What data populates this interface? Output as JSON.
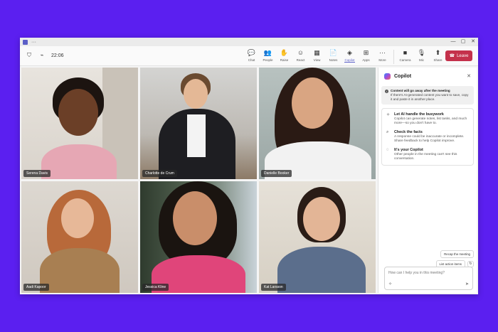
{
  "titlebar": {
    "more": "···",
    "controls": [
      "—",
      "▢",
      "✕"
    ]
  },
  "toolbar": {
    "timer": "22:06",
    "buttons": [
      {
        "label": "Chat",
        "icon": "chat-icon",
        "glyph": "💬"
      },
      {
        "label": "People",
        "icon": "people-icon",
        "glyph": "👥"
      },
      {
        "label": "Raise",
        "icon": "raise-hand-icon",
        "glyph": "✋"
      },
      {
        "label": "React",
        "icon": "react-icon",
        "glyph": "☺"
      },
      {
        "label": "View",
        "icon": "view-icon",
        "glyph": "▦"
      },
      {
        "label": "Notes",
        "icon": "notes-icon",
        "glyph": "📄"
      },
      {
        "label": "Copilot",
        "icon": "copilot-icon",
        "glyph": "◈"
      },
      {
        "label": "Apps",
        "icon": "apps-icon",
        "glyph": "⊞"
      },
      {
        "label": "More",
        "icon": "more-icon",
        "glyph": "···"
      }
    ],
    "media": [
      {
        "label": "Camera",
        "icon": "camera-icon",
        "glyph": "■"
      },
      {
        "label": "Mic",
        "icon": "mic-icon",
        "glyph": "🎙"
      },
      {
        "label": "Share",
        "icon": "share-icon",
        "glyph": "⬆"
      }
    ],
    "leave_label": "Leave"
  },
  "participants": [
    {
      "name": "Serena Davis"
    },
    {
      "name": "Charlotte de Crum"
    },
    {
      "name": "Danielle Booker"
    },
    {
      "name": "Aadi Kapoor"
    },
    {
      "name": "Jessica Kline"
    },
    {
      "name": "Kat Larsson"
    }
  ],
  "copilot": {
    "title": "Copilot",
    "notice_bold": "Content will go away after the meeting",
    "notice_text": "If there's AI-generated content you want to save, copy it and paste it in another place.",
    "items": [
      {
        "title": "Let AI handle the busywork",
        "desc": "Copilot can generate notes, list tasks, and much more—so you don't have to."
      },
      {
        "title": "Check the facts",
        "desc": "A response could be inaccurate or incomplete. Share feedback to help Copilot improve."
      },
      {
        "title": "It's your Copilot",
        "desc": "Other people in the meeting can't see this conversation."
      }
    ],
    "chips": [
      "Recap the meeting",
      "List action items"
    ],
    "input_placeholder": "How can I help you in this meeting?"
  },
  "colors": {
    "background": "#5b1ff0",
    "accent": "#5b5fc7",
    "leave": "#c4314b"
  }
}
